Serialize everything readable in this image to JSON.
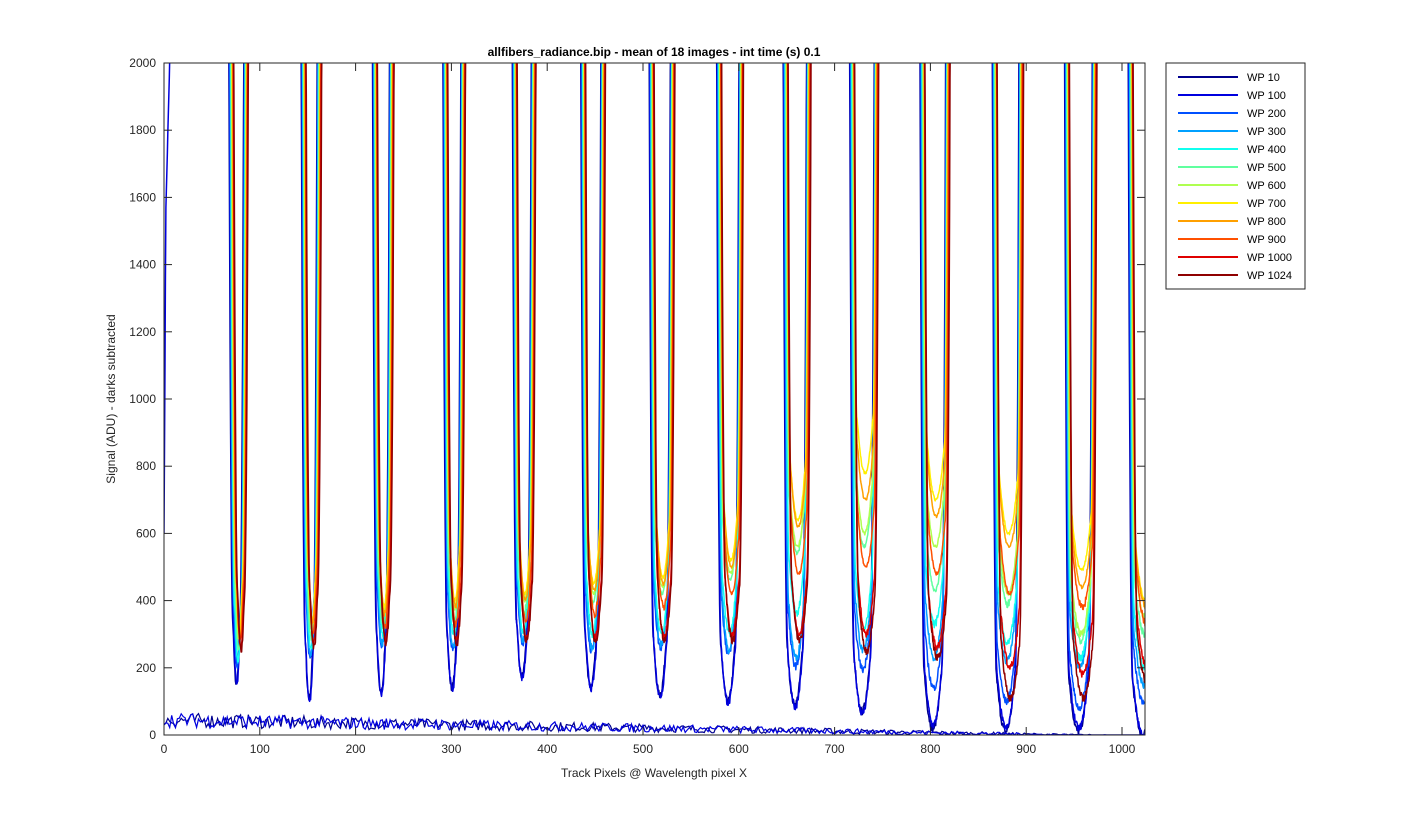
{
  "chart_data": {
    "type": "line",
    "title": "allfibers_radiance.bip - mean of 18 images - int time (s) 0.1",
    "xlabel": "Track Pixels @ Wavelength pixel X",
    "ylabel": "Signal (ADU) - darks subtracted",
    "xlim": [
      0,
      1024
    ],
    "ylim": [
      0,
      2000
    ],
    "x_ticks": [
      0,
      100,
      200,
      300,
      400,
      500,
      600,
      700,
      800,
      900,
      1000
    ],
    "y_ticks": [
      0,
      200,
      400,
      600,
      800,
      1000,
      1200,
      1400,
      1600,
      1800,
      2000
    ],
    "grid": false,
    "legend_position": "outside-right",
    "trough_centers": [
      78,
      154,
      229,
      303,
      376,
      448,
      520,
      591,
      661,
      731,
      805,
      881,
      957,
      1024
    ],
    "series": [
      {
        "name": "WP 10",
        "color": "#00008f",
        "minima": [
          150,
          110,
          125,
          140,
          175,
          145,
          120,
          100,
          90,
          70,
          20,
          10,
          10,
          0
        ],
        "baseline_noise": [
          30,
          0
        ]
      },
      {
        "name": "WP 100",
        "color": "#0000df",
        "minima": [
          150,
          100,
          120,
          135,
          170,
          140,
          115,
          95,
          85,
          65,
          30,
          20,
          20,
          0
        ],
        "baseline_noise": [
          30,
          0
        ],
        "left_edge_rise": true
      },
      {
        "name": "WP 200",
        "color": "#0050ff",
        "minima": [
          200,
          230,
          260,
          250,
          275,
          250,
          260,
          240,
          205,
          195,
          140,
          100,
          80,
          100
        ]
      },
      {
        "name": "WP 300",
        "color": "#00a0ff",
        "minima": [
          210,
          230,
          270,
          260,
          280,
          260,
          270,
          250,
          230,
          250,
          230,
          220,
          200,
          150
        ]
      },
      {
        "name": "WP 400",
        "color": "#10ffef",
        "minima": [
          220,
          260,
          300,
          300,
          300,
          300,
          300,
          300,
          360,
          320,
          330,
          270,
          230,
          200
        ]
      },
      {
        "name": "WP 500",
        "color": "#60ff9f",
        "minima": [
          260,
          290,
          320,
          330,
          360,
          390,
          420,
          460,
          540,
          560,
          430,
          390,
          280,
          300
        ]
      },
      {
        "name": "WP 600",
        "color": "#afff50",
        "minima": [
          290,
          320,
          360,
          380,
          400,
          420,
          440,
          480,
          560,
          600,
          560,
          420,
          300,
          350
        ]
      },
      {
        "name": "WP 700",
        "color": "#ffef00",
        "minima": [
          300,
          340,
          380,
          400,
          420,
          450,
          470,
          520,
          640,
          780,
          700,
          600,
          490,
          400
        ]
      },
      {
        "name": "WP 800",
        "color": "#ffa000",
        "minima": [
          290,
          330,
          360,
          380,
          400,
          430,
          450,
          500,
          620,
          700,
          650,
          560,
          440,
          380
        ]
      },
      {
        "name": "WP 900",
        "color": "#ff5000",
        "minima": [
          280,
          300,
          320,
          330,
          340,
          360,
          380,
          420,
          480,
          500,
          480,
          420,
          380,
          330
        ]
      },
      {
        "name": "WP 1000",
        "color": "#df0000",
        "minima": [
          260,
          270,
          280,
          280,
          290,
          290,
          290,
          300,
          300,
          300,
          260,
          200,
          180,
          200
        ]
      },
      {
        "name": "WP 1024",
        "color": "#8f0000",
        "minima": [
          250,
          260,
          270,
          270,
          280,
          280,
          280,
          280,
          280,
          250,
          230,
          110,
          110,
          150
        ]
      }
    ]
  }
}
